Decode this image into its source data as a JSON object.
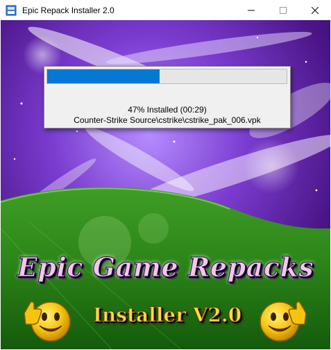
{
  "window": {
    "title": "Epic Repack Installer 2.0",
    "controls": [
      "minimize",
      "maximize",
      "close"
    ]
  },
  "progress": {
    "fraction": 0.47,
    "status_text": "47% Installed (00:29)",
    "current_file": "Counter-Strike Source\\cstrike\\cstrike_pak_006.vpk",
    "fill_color": "#0678d4"
  },
  "branding": {
    "title": "Epic Game Repacks",
    "subtitle": "Installer V2.0"
  },
  "icons": [
    "app-icon",
    "minimize-icon",
    "maximize-icon",
    "close-icon",
    "thumbs-up-smiley-icon"
  ],
  "colors": {
    "sky_purple": "#5a1a9a",
    "grass_green": "#2f8a1e",
    "title_pink": "#f2c8e6",
    "subtitle_gold": "#f7d94b"
  }
}
